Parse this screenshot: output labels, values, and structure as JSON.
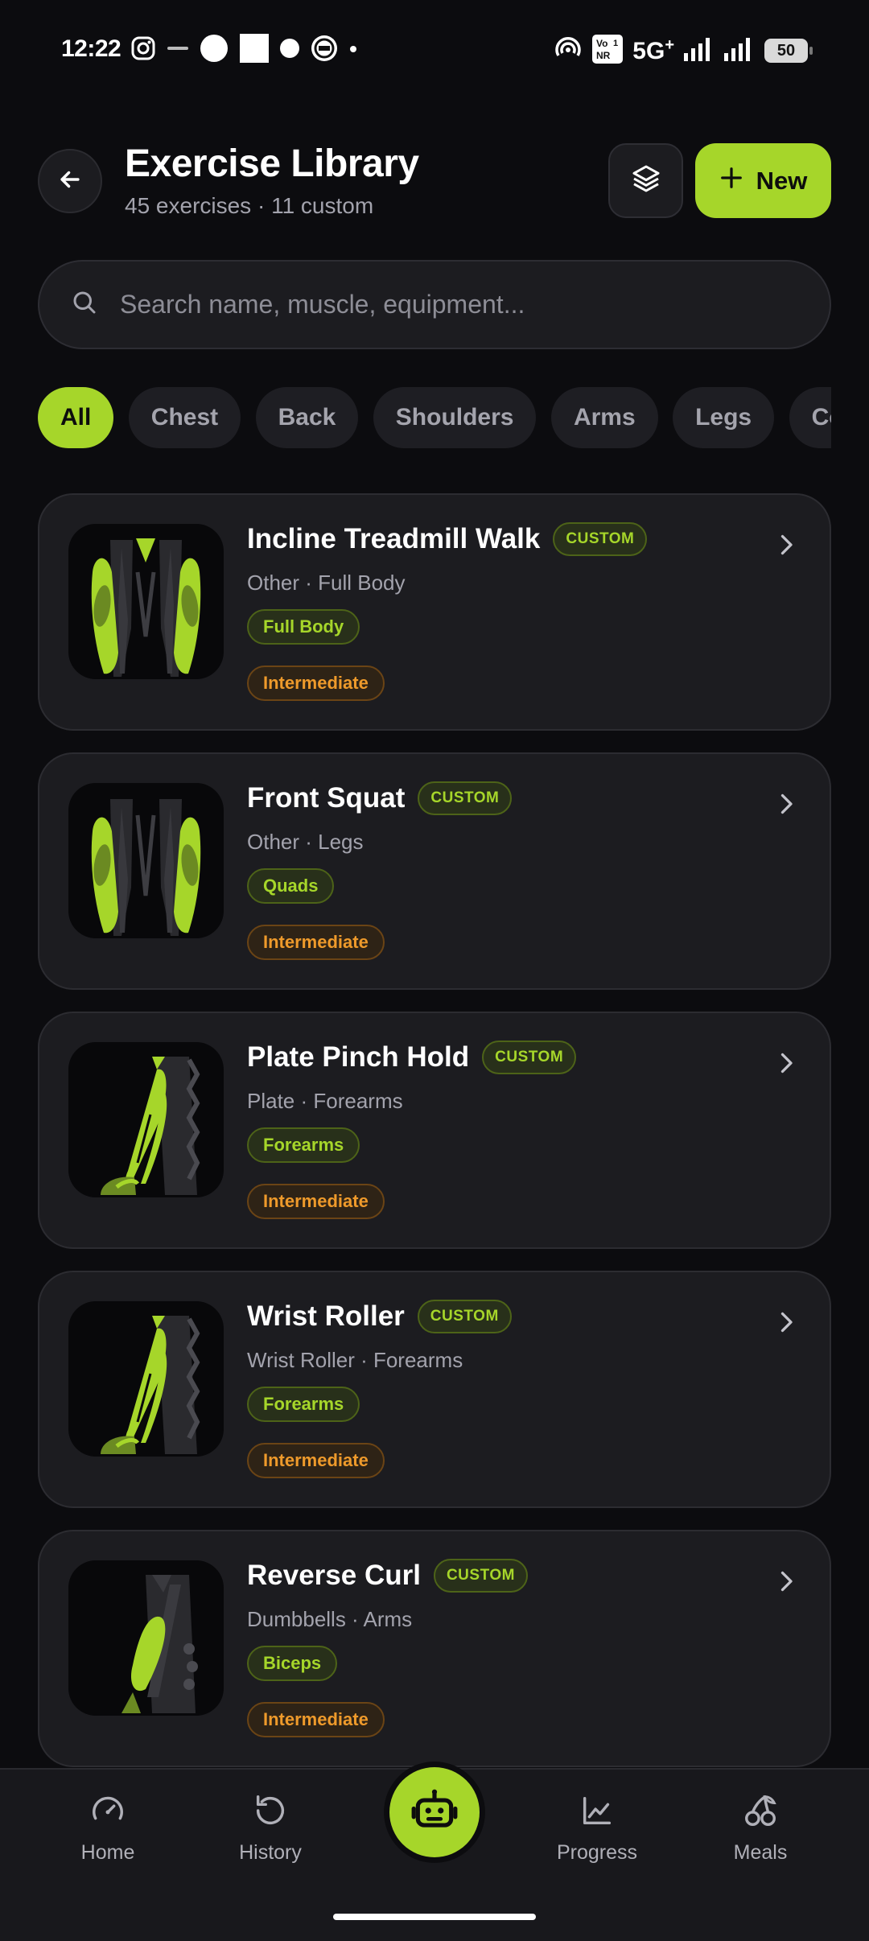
{
  "status_bar": {
    "time": "12:22",
    "left_icons": [
      "instagram-icon",
      "rapido-icon",
      "circle-icon",
      "square-icon",
      "dot-icon",
      "app-badge-icon",
      "small-dot-icon"
    ],
    "network_text": "5G",
    "network_sup": "+",
    "volte_text": "Vo NR 1",
    "battery": "50"
  },
  "header": {
    "title": "Exercise Library",
    "subtitle": "45 exercises · 11 custom",
    "new_label": "New"
  },
  "search": {
    "placeholder": "Search name, muscle, equipment..."
  },
  "filters": {
    "chips": [
      "All",
      "Chest",
      "Back",
      "Shoulders",
      "Arms",
      "Legs",
      "Core"
    ],
    "active": "All"
  },
  "exercises": [
    {
      "name": "Incline Treadmill Walk",
      "badge": "CUSTOM",
      "meta": "Other · Full Body",
      "muscle": "Full Body",
      "level": "Intermediate",
      "thumbnail": "legs-front-icon"
    },
    {
      "name": "Front Squat",
      "badge": "CUSTOM",
      "meta": "Other · Legs",
      "muscle": "Quads",
      "level": "Intermediate",
      "thumbnail": "legs-front-icon"
    },
    {
      "name": "Plate Pinch Hold",
      "badge": "CUSTOM",
      "meta": "Plate · Forearms",
      "muscle": "Forearms",
      "level": "Intermediate",
      "thumbnail": "forearm-icon"
    },
    {
      "name": "Wrist Roller",
      "badge": "CUSTOM",
      "meta": "Wrist Roller · Forearms",
      "muscle": "Forearms",
      "level": "Intermediate",
      "thumbnail": "forearm-icon"
    },
    {
      "name": "Reverse Curl",
      "badge": "CUSTOM",
      "meta": "Dumbbells · Arms",
      "muscle": "Biceps",
      "level": "Intermediate",
      "thumbnail": "biceps-icon"
    }
  ],
  "bottom_nav": {
    "items": [
      {
        "label": "Home",
        "icon": "gauge-icon"
      },
      {
        "label": "History",
        "icon": "history-icon"
      },
      {
        "label": "",
        "icon": "robot-icon"
      },
      {
        "label": "Progress",
        "icon": "chart-line-icon"
      },
      {
        "label": "Meals",
        "icon": "cherries-icon"
      }
    ]
  },
  "colors": {
    "accent": "#a6d62a",
    "background": "#0c0c0f",
    "card": "#1c1c20",
    "level": "#ee9a2b"
  }
}
